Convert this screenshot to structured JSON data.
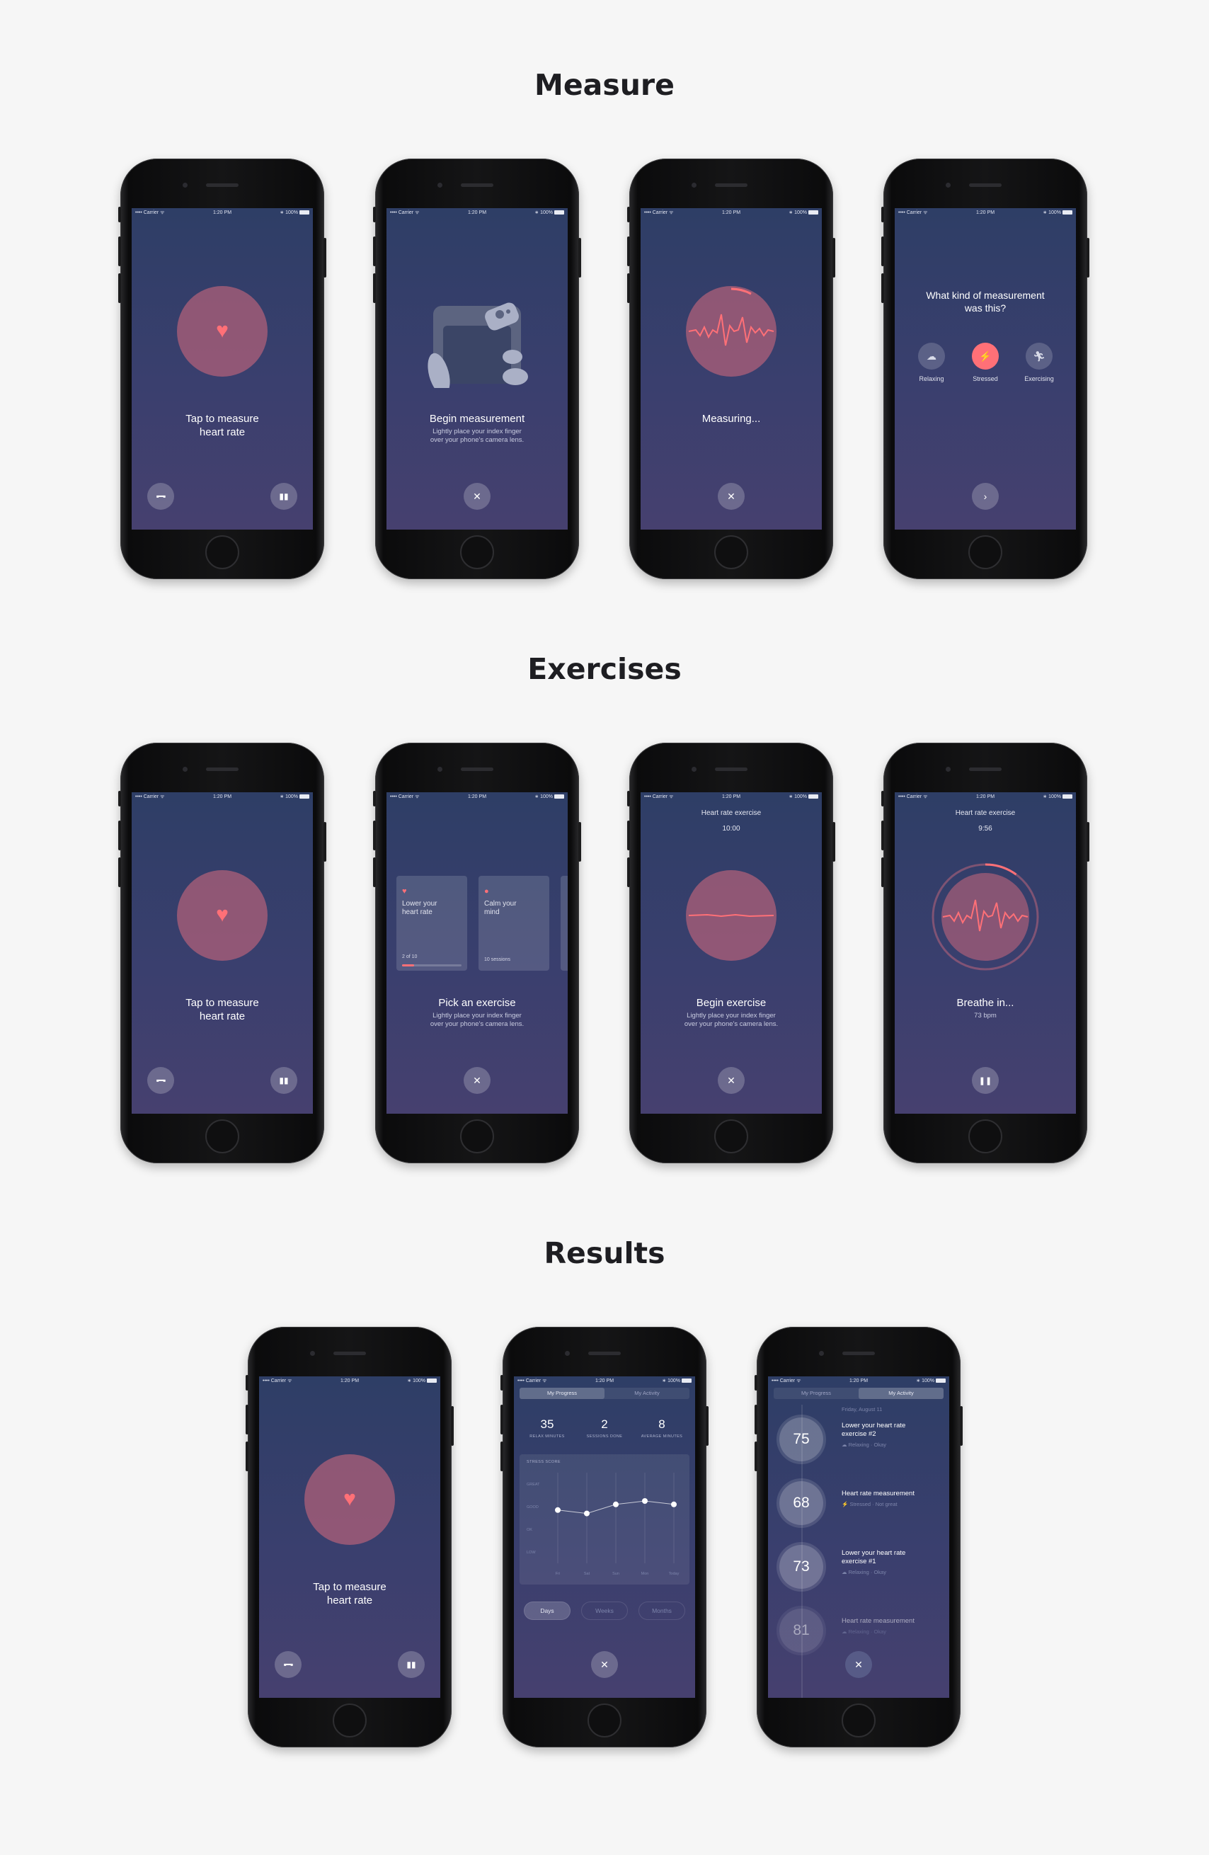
{
  "sections": {
    "measure": "Measure",
    "exercises": "Exercises",
    "results": "Results"
  },
  "status_bar": {
    "carrier": "•••• Carrier ᯤ",
    "time": "1:20 PM",
    "battery": "∗ 100%"
  },
  "colors": {
    "accent": "#ff7077",
    "bg_top": "#2e3e66",
    "bg_bottom": "#46406f",
    "page": "#f6f6f6"
  },
  "icons": {
    "heart": "heart-icon",
    "dumbbell": "dumbbell-icon",
    "chart": "chart-icon",
    "close": "close-icon",
    "next": "chevron-right-icon",
    "pause": "pause-icon"
  },
  "measure": {
    "home": {
      "caption": "Tap to measure\nheart rate"
    },
    "begin": {
      "title": "Begin measurement",
      "subtitle": "Lightly place your index finger\nover your phone's camera lens."
    },
    "measuring": {
      "title": "Measuring..."
    },
    "kind": {
      "question": "What kind of measurement\nwas this?",
      "options": [
        {
          "label": "Relaxing",
          "icon": "relax-icon"
        },
        {
          "label": "Stressed",
          "icon": "stressed-icon"
        },
        {
          "label": "Exercising",
          "icon": "running-icon"
        }
      ]
    }
  },
  "exercises": {
    "home": {
      "caption": "Tap to measure\nheart rate"
    },
    "pick": {
      "title": "Pick an exercise",
      "subtitle": "Lightly place your index finger\nover your phone's camera lens.",
      "cards": [
        {
          "label": "Lower your\nheart rate",
          "meta": "2 of 10",
          "progress": 0.2
        },
        {
          "label": "Calm your\nmind",
          "meta": "10 sessions"
        }
      ]
    },
    "begin": {
      "header": "Heart rate exercise",
      "timer": "10:00",
      "title": "Begin exercise",
      "subtitle": "Lightly place your index finger\nover your phone's camera lens."
    },
    "breathe": {
      "header": "Heart rate exercise",
      "timer": "9:56",
      "title": "Breathe in...",
      "subtitle": "73 bpm",
      "progress": 0.1
    }
  },
  "results": {
    "home": {
      "caption": "Tap to measure\nheart rate"
    },
    "progress": {
      "tabs": [
        "My Progress",
        "My Activity"
      ],
      "stats": [
        {
          "value": "35",
          "label": "RELAX MINUTES"
        },
        {
          "value": "2",
          "label": "SESSIONS DONE"
        },
        {
          "value": "8",
          "label": "AVERAGE MINUTES"
        }
      ],
      "chart_label": "STRESS SCORE",
      "periods": [
        "Days",
        "Weeks",
        "Months"
      ]
    },
    "activity": {
      "tabs": [
        "My Progress",
        "My Activity"
      ],
      "date": "Friday, August 11",
      "items": [
        {
          "value": "75",
          "title": "Lower your heart rate\nexercise #2",
          "tag1": "Relaxing",
          "tag2": "Okay"
        },
        {
          "value": "68",
          "title": "Heart rate measurement",
          "tag1": "Stressed",
          "tag2": "Not great"
        },
        {
          "value": "73",
          "title": "Lower your heart rate\nexercise #1",
          "tag1": "Relaxing",
          "tag2": "Okay"
        },
        {
          "value": "81",
          "title": "Heart rate measurement",
          "tag1": "Relaxing",
          "tag2": "Okay"
        }
      ]
    }
  },
  "chart_data": {
    "type": "line",
    "title": "STRESS SCORE",
    "categories": [
      "Fri",
      "Sat",
      "Sun",
      "Mon",
      "Today"
    ],
    "y_tick_labels": [
      "GREAT",
      "GOOD",
      "OK",
      "LOW"
    ],
    "values": [
      2.35,
      2.2,
      2.6,
      2.75,
      2.6
    ],
    "ylim": [
      0,
      4
    ],
    "grid": true
  }
}
